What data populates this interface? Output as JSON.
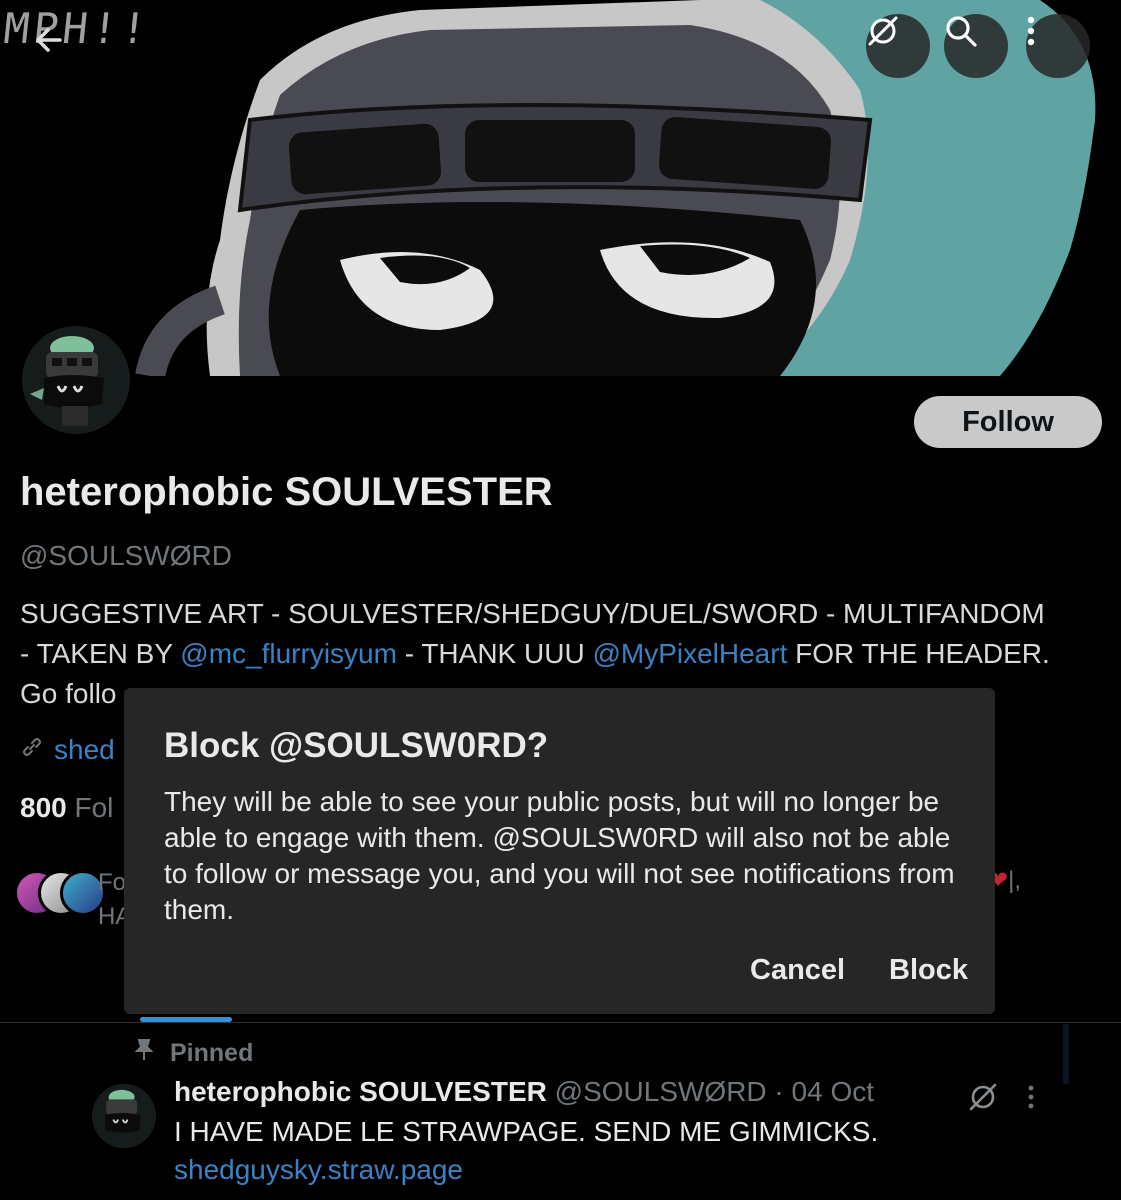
{
  "header": {
    "sketch_text": "MPH!!",
    "back_icon": "back-arrow-icon",
    "grok_icon": "grok-icon",
    "search_icon": "search-icon",
    "more_icon": "more-vertical-icon",
    "colors": {
      "teal": "#5fa3a3",
      "shadow": "#4a4a52",
      "light": "#c7c7c7"
    }
  },
  "profile": {
    "follow_label": "Follow",
    "display_name": "heterophobic SOULVESTER",
    "handle": "@SOULSWØRD",
    "bio": {
      "line1": "SUGGESTIVE ART - SOULVESTER/SHEDGUY/DUEL/SWORD - MULTIFANDOM",
      "line2_prefix": "- TAKEN BY ",
      "mention1": "@mc_flurryisyum",
      "line2_mid": " - THANK UUU ",
      "mention2": "@MyPixelHeart",
      "line2_suffix": " FOR THE HEADER.",
      "line3": "Go follo"
    },
    "link_text": "shed",
    "following_count": "800",
    "following_label": "Fol",
    "followed_by_line1": "Fo",
    "followed_by_line2": "HA",
    "followed_by_tail": "|,"
  },
  "dialog": {
    "title": "Block @SOULSW0RD?",
    "body": "They will be able to see your public posts, but will no longer be able to engage with them. @SOULSW0RD will also not be able to follow or message you, and you will not see notifications from them.",
    "cancel_label": "Cancel",
    "block_label": "Block"
  },
  "pinned_post": {
    "pinned_label": "Pinned",
    "author_name": "heterophobic SOULVESTER",
    "author_meta": "@SOULSWØRD · 04 Oct",
    "text": "I HAVE MADE LE STRAWPAGE. SEND ME GIMMICKS.",
    "link": "shedguysky.straw.page"
  }
}
